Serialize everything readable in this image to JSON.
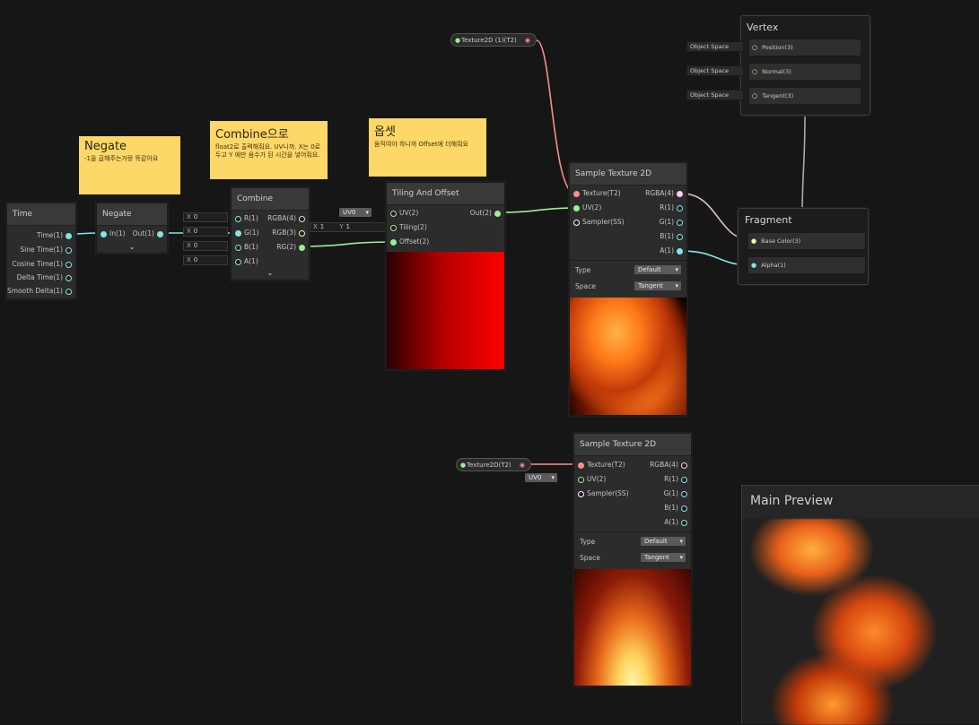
{
  "colors": {
    "canvas": "#161616",
    "node": "#2c2c2c",
    "header": "#393939",
    "sticky": "#fdd767",
    "float": "#84e4e7",
    "vec2": "#9aef92",
    "vec3": "#f6ff9a",
    "vec4": "#fbcbf4",
    "texture": "#ff8b8b",
    "sampler": "#ffffff"
  },
  "nodes": {
    "time": {
      "title": "Time",
      "ports": [
        "Time(1)",
        "Sine Time(1)",
        "Cosine Time(1)",
        "Delta Time(1)",
        "Smooth Delta(1)"
      ]
    },
    "negate": {
      "title": "Negate",
      "in": "In(1)",
      "out": "Out(1)"
    },
    "combine": {
      "title": "Combine",
      "inputs": [
        "R(1)",
        "G(1)",
        "B(1)",
        "A(1)"
      ],
      "outputs": [
        "RGBA(4)",
        "RGB(3)",
        "RG(2)"
      ],
      "x_label": "X",
      "x_value": "0"
    },
    "tiling": {
      "title": "Tiling And Offset",
      "inputs": [
        "UV(2)",
        "Tiling(2)",
        "Offset(2)"
      ],
      "output": "Out(2)",
      "uv_value": "UV0",
      "tx": "X",
      "tx_val": "1",
      "ty": "Y",
      "ty_val": "1"
    },
    "sample1": {
      "title": "Sample Texture 2D",
      "inputs": [
        "Texture(T2)",
        "UV(2)",
        "Sampler(SS)"
      ],
      "outputs": [
        "RGBA(4)",
        "R(1)",
        "G(1)",
        "B(1)",
        "A(1)"
      ],
      "type_label": "Type",
      "type_value": "Default",
      "space_label": "Space",
      "space_value": "Tangent"
    },
    "sample2": {
      "title": "Sample Texture 2D",
      "inputs": [
        "Texture(T2)",
        "UV(2)",
        "Sampler(SS)"
      ],
      "outputs": [
        "RGBA(4)",
        "R(1)",
        "G(1)",
        "B(1)",
        "A(1)"
      ],
      "type_label": "Type",
      "type_value": "Default",
      "space_label": "Space",
      "space_value": "Tangent",
      "uv_value": "UV0"
    },
    "vertex": {
      "title": "Vertex",
      "ports": [
        "Position(3)",
        "Normal(3)",
        "Tangent(3)"
      ],
      "context": "Object Space"
    },
    "fragment": {
      "title": "Fragment",
      "ports": [
        "Base Color(3)",
        "Alpha(1)"
      ]
    },
    "prop1": {
      "label": "Texture2D (1)(T2)"
    },
    "prop2": {
      "label": "Texture2D(T2)"
    }
  },
  "stickies": {
    "negate": {
      "title": "Negate",
      "body": "-1을 곱해주는거랑 똑같아요"
    },
    "combine": {
      "title": "Combine으로",
      "body": "float2로 출력해줘요. UV니까. X는 0로 두고 Y 에만 음수가 된 시간을 넣어줘요."
    },
    "offset": {
      "title": "옵셋",
      "body": "움직여야 하니까 Offset에 더해줘요"
    }
  },
  "main_preview": {
    "title": "Main Preview"
  }
}
